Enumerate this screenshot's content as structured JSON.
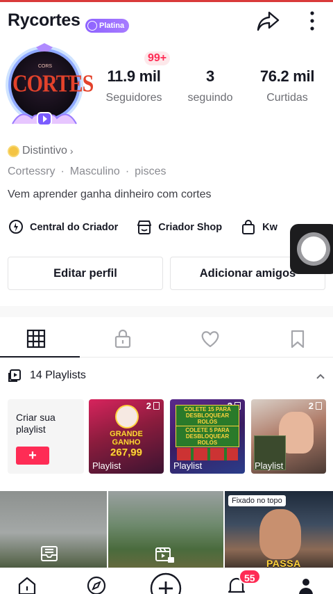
{
  "header": {
    "username": "Rycortes",
    "badge_label": "Platina",
    "share_icon": "share-arrow-icon",
    "more_icon": "more-vertical-icon"
  },
  "avatar": {
    "main_text": "CORTES",
    "small_text": "CORS"
  },
  "notifications_badge": "99+",
  "stats": [
    {
      "value": "11.9 mil",
      "label": "Seguidores"
    },
    {
      "value": "3",
      "label": "seguindo"
    },
    {
      "value": "76.2 mil",
      "label": "Curtidas"
    }
  ],
  "distintivo": "Distintivo",
  "meta": {
    "handle": "Cortessry",
    "gender": "Masculino",
    "sign": "pisces",
    "separator": "·"
  },
  "bio": "Vem aprender ganha dinheiro com cortes",
  "tools": [
    {
      "label": "Central do Criador",
      "icon": "lightbulb-pin-icon"
    },
    {
      "label": "Criador Shop",
      "icon": "shop-icon"
    },
    {
      "label": "Kw",
      "icon": "shopping-bag-icon"
    }
  ],
  "actions": {
    "edit_profile": "Editar perfil",
    "add_friends": "Adicionar amigos"
  },
  "tabs": [
    "grid-icon",
    "lock-icon",
    "heart-icon",
    "bookmark-icon"
  ],
  "playlists": {
    "title": "14 Playlists",
    "create_label": "Criar sua playlist",
    "create_button": "+",
    "cards": [
      {
        "count": "2",
        "label": "Playlist",
        "line1": "GRANDE",
        "line2": "GANHO",
        "amount": "267,99"
      },
      {
        "count": "2",
        "label": "Playlist",
        "banner1": "COLETE 15 PARA DESBLOQUEAR ROLOS",
        "banner2": "COLETE 5 PARA DESBLOQUEAR ROLOS"
      },
      {
        "count": "2",
        "label": "Playlist"
      }
    ]
  },
  "videos": {
    "pinned_label": "Fixado no topo",
    "overlay_text": "PASSA"
  },
  "bottom_nav": {
    "items": [
      "home-icon",
      "explore-icon",
      "create-icon",
      "inbox-icon",
      "profile-icon"
    ],
    "inbox_badge": "55"
  },
  "colors": {
    "accent": "#fe2c55",
    "badge_purple": "#8e63ff",
    "text_primary": "#161823",
    "text_secondary": "#6c6d73"
  }
}
